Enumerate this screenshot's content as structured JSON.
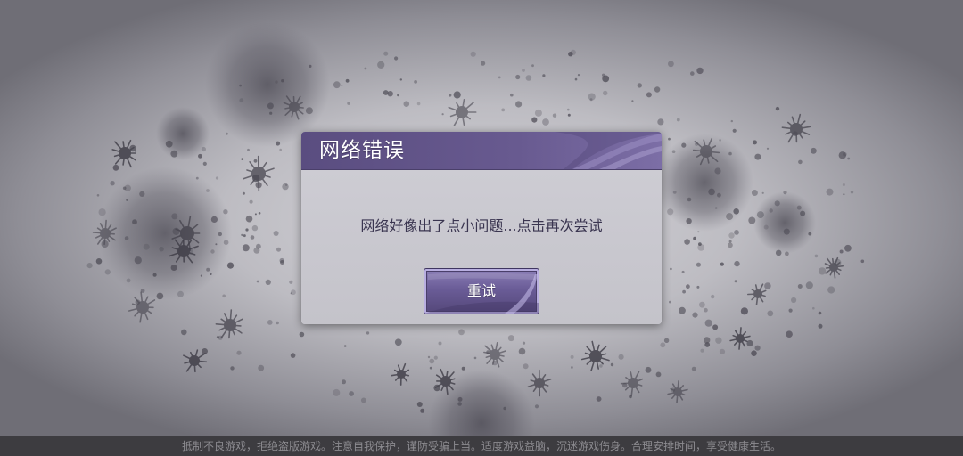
{
  "dialog": {
    "title": "网络错误",
    "message": "网络好像出了点小问题...点击再次尝试",
    "retry_label": "重试"
  },
  "footer": {
    "notice": "抵制不良游戏，拒绝盗版游戏。注意自我保护，谨防受骗上当。适度游戏益脑，沉迷游戏伤身。合理安排时间，享受健康生活。"
  },
  "background": {
    "art_icon": "spiky-spore-pattern"
  },
  "colors": {
    "header": "#685a90",
    "button": "#6a5c97",
    "dialog_body": "#c9c8cf",
    "footer_bar": "#3d3c40"
  }
}
